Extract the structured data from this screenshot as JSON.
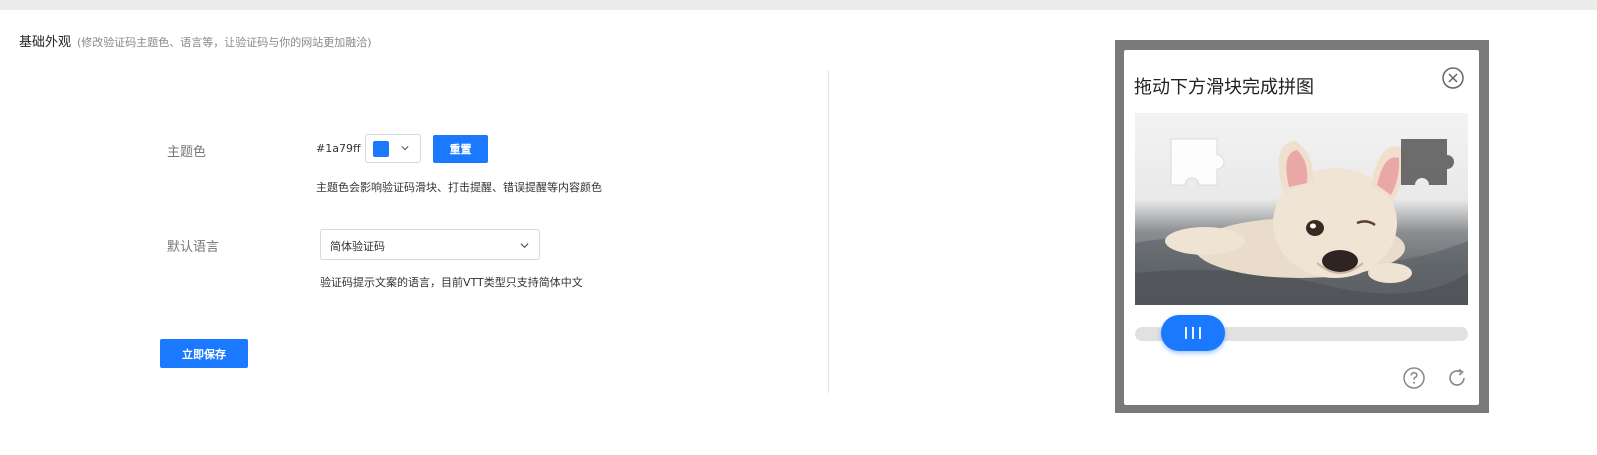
{
  "section": {
    "title": "基础外观",
    "subtitle": "(修改验证码主题色、语言等，让验证码与你的网站更加融洽)"
  },
  "theme_color": {
    "label": "主题色",
    "hex_text": "#1a79ff",
    "swatch_color": "#1a79ff",
    "reset_label": "重置",
    "help": "主题色会影响验证码滑块、打击提醒、错误提醒等内容颜色"
  },
  "language": {
    "label": "默认语言",
    "selected": "简体验证码",
    "help": "验证码提示文案的语言，目前VTT类型只支持简体中文"
  },
  "save_label": "立即保存",
  "captcha": {
    "title": "拖动下方滑块完成拼图",
    "slider_progress": 0.1,
    "icons": {
      "close": "close-circle-icon",
      "help": "help-icon",
      "refresh": "refresh-icon",
      "knob": "drag-grip-icon"
    },
    "accent_color": "#1a79ff"
  }
}
